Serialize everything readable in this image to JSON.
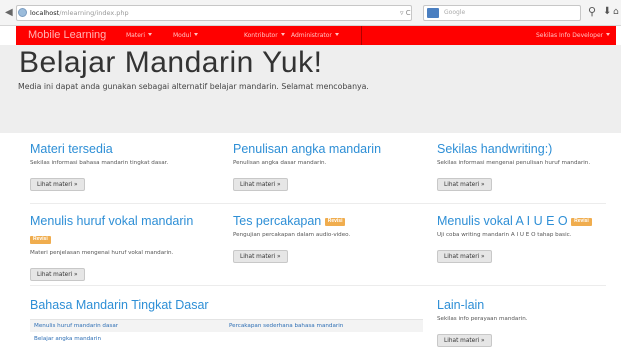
{
  "browser": {
    "url_host": "localhost",
    "url_path": "/mlearning/index.php",
    "search_placeholder": "Google"
  },
  "navbar": {
    "brand": "Mobile Learning",
    "items": [
      "Materi",
      "Modul",
      "Kontributor",
      "Administrator"
    ],
    "right_item": "Sekilas Info Developer"
  },
  "jumbotron": {
    "title": "Belajar Mandarin Yuk!",
    "lead": "Media ini dapat anda gunakan sebagai alternatif belajar mandarin. Selamat mencobanya."
  },
  "cards": [
    {
      "title": "Materi tersedia",
      "desc": "Sekilas informasi bahasa mandarin tingkat dasar.",
      "button": "Lihat materi »"
    },
    {
      "title": "Penulisan angka mandarin",
      "desc": "Penulisan angka dasar mandarin.",
      "button": "Lihat materi »"
    },
    {
      "title": "Sekilas handwriting:)",
      "desc": "Sekilas informasi mengenai penulisan huruf mandarin.",
      "button": "Lihat materi »"
    },
    {
      "title": "Menulis huruf vokal mandarin",
      "badge": "Revisi",
      "desc": "Materi penjelasan mengenai huruf vokal mandarin.",
      "button": "Lihat materi »"
    },
    {
      "title": "Tes percakapan",
      "badge": "Revisi",
      "desc": "Pengujian percakapan dalam audio-video.",
      "button": "Lihat materi »"
    },
    {
      "title": "Menulis vokal A I U E O",
      "badge": "Revisi",
      "desc": "Uji coba writing mandarin A I U E O tahap basic.",
      "button": "Lihat materi »"
    }
  ],
  "basic": {
    "title": "Bahasa Mandarin Tingkat Dasar",
    "links": [
      [
        "Menulis huruf mandarin dasar",
        "Percakapan sederhana bahasa mandarin"
      ],
      [
        "Belajar angka mandarin",
        ""
      ]
    ]
  },
  "lainlain": {
    "title": "Lain-lain",
    "desc": "Sekilas info perayaan mandarin.",
    "button": "Lihat materi »"
  }
}
